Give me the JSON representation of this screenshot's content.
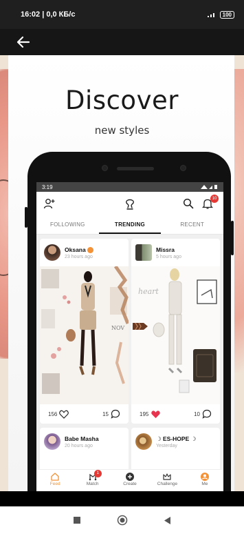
{
  "status_bar": {
    "time_net": "16:02 | 0,0 КБ/с",
    "battery": "100"
  },
  "promo": {
    "title": "Discover",
    "subtitle": "new styles"
  },
  "app": {
    "status_time": "3:19",
    "tabs": [
      {
        "label": "FOLLOWING",
        "active": false
      },
      {
        "label": "TRENDING",
        "active": true
      },
      {
        "label": "RECENT",
        "active": false
      }
    ],
    "posts": [
      {
        "user": "Oksana",
        "time": "23 hours ago",
        "likes": "156",
        "comments": "15",
        "liked": false,
        "verified": true
      },
      {
        "user": "Missra",
        "time": "5 hours ago",
        "likes": "195",
        "comments": "10",
        "liked": true,
        "verified": false
      },
      {
        "user": "Babe Masha",
        "time": "20 hours ago"
      },
      {
        "user": "☽ ES-HOPE ☽",
        "time": "Yesterday"
      }
    ],
    "nav": [
      {
        "label": "Feed",
        "icon": "home-icon",
        "active": true
      },
      {
        "label": "Match",
        "icon": "match-icon",
        "badge": "1"
      },
      {
        "label": "Create",
        "icon": "plus-icon"
      },
      {
        "label": "Challenge",
        "icon": "crown-icon"
      },
      {
        "label": "Me",
        "icon": "profile-icon"
      }
    ],
    "notification_count": "10"
  },
  "colors": {
    "accent": "#f39236",
    "like": "#e8344e",
    "badge": "#e53935"
  }
}
